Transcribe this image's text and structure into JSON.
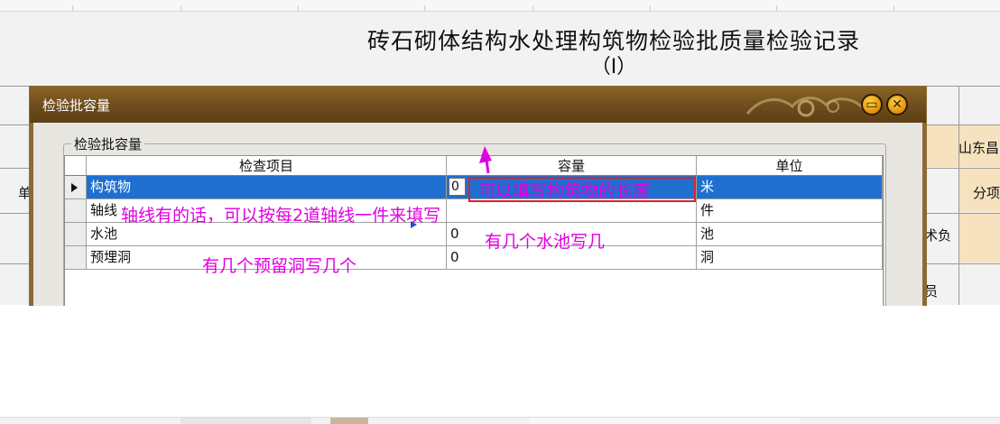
{
  "document": {
    "title": "砖石砌体结构水处理构筑物检验批质量检验记录",
    "subtitle": "（Ⅰ）"
  },
  "background_cells": {
    "org_fragment": "山东昌",
    "sub_item_fragment": "分项",
    "left_fragment": "单",
    "tech_fragment": "术负",
    "staff_fragment": "员"
  },
  "dialog": {
    "title": "检验批容量",
    "group_label": "检验批容量",
    "columns": [
      "检查项目",
      "容量",
      "单位"
    ],
    "rows": [
      {
        "item": "构筑物",
        "capacity": "0",
        "unit": "米",
        "selected": true
      },
      {
        "item": "轴线",
        "capacity": "",
        "unit": "件",
        "selected": false
      },
      {
        "item": "水池",
        "capacity": "0",
        "unit": "池",
        "selected": false
      },
      {
        "item": "预埋洞",
        "capacity": "0",
        "unit": "洞",
        "selected": false
      }
    ],
    "buttons": {
      "minimize_icon": "minimize-icon",
      "close_icon": "close-icon"
    }
  },
  "annotations": {
    "structure_length": "可以填写构筑物的长度",
    "axis_lines": "轴线有的话，可以按每2道轴线一件来填写",
    "pool": "有几个水池写几",
    "reserved_holes": "有几个预留洞写几个",
    "color": "#e000e0",
    "box_color": "#e02020"
  },
  "colors": {
    "titlebar": "#6d4c1c",
    "selection": "#1f6fd0",
    "header_gold": "#f6e2bf"
  }
}
